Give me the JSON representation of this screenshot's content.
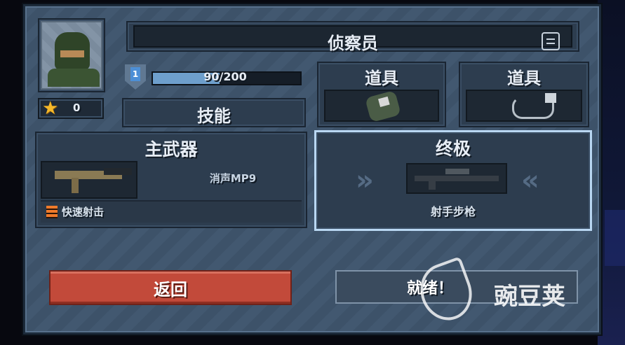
{
  "header": {
    "title": "侦察员"
  },
  "character": {
    "stars": "0"
  },
  "level": {
    "number": "1",
    "xp_text": "90/200",
    "xp_fraction": 0.45,
    "skill_label": "技能"
  },
  "items": [
    {
      "label": "道具",
      "icon": "gloves-icon"
    },
    {
      "label": "道具",
      "icon": "device-icon"
    }
  ],
  "primary_weapon": {
    "header": "主武器",
    "name": "消声MP9",
    "perk": "快速射击"
  },
  "ultimate": {
    "header": "终极",
    "name": "射手步枪"
  },
  "buttons": {
    "back": "返回",
    "ready": "就绪！"
  },
  "watermark": {
    "text": "豌豆荚"
  },
  "colors": {
    "back_button": "#c24a3a",
    "panel": "#425870",
    "star": "#f5b82a",
    "xp_fill": "#6e9fcc"
  }
}
